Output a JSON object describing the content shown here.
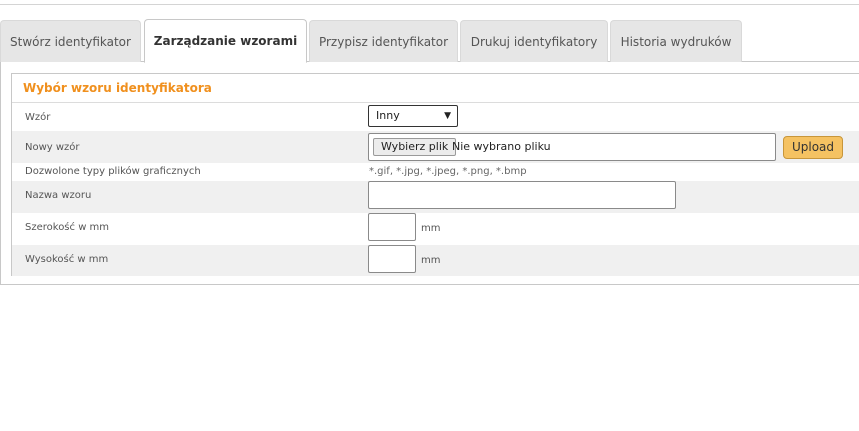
{
  "tabs": [
    {
      "label": "Stwórz identyfikator"
    },
    {
      "label": "Zarządzanie wzorami"
    },
    {
      "label": "Przypisz identyfikator"
    },
    {
      "label": "Drukuj identyfikatory"
    },
    {
      "label": "Historia wydruków"
    }
  ],
  "panel": {
    "title": "Wybór wzoru identyfikatora",
    "template": {
      "label": "Wzór",
      "value": "Inny"
    },
    "new_template": {
      "label": "Nowy wzór",
      "choose_button": "Wybierz plik",
      "file_status": "Nie wybrano pliku",
      "upload_button": "Upload"
    },
    "allowed_types": {
      "label": "Dozwolone typy plików graficznych",
      "value": "*.gif, *.jpg, *.jpeg, *.png, *.bmp"
    },
    "template_name": {
      "label": "Nazwa wzoru",
      "value": ""
    },
    "width": {
      "label": "Szerokość w mm",
      "value": "",
      "unit": "mm"
    },
    "height": {
      "label": "Wysokość w mm",
      "value": "",
      "unit": "mm"
    }
  },
  "colors": {
    "accent": "#f0901e",
    "upload_button": "#f5c262",
    "row_gray": "#f0f0f0"
  }
}
